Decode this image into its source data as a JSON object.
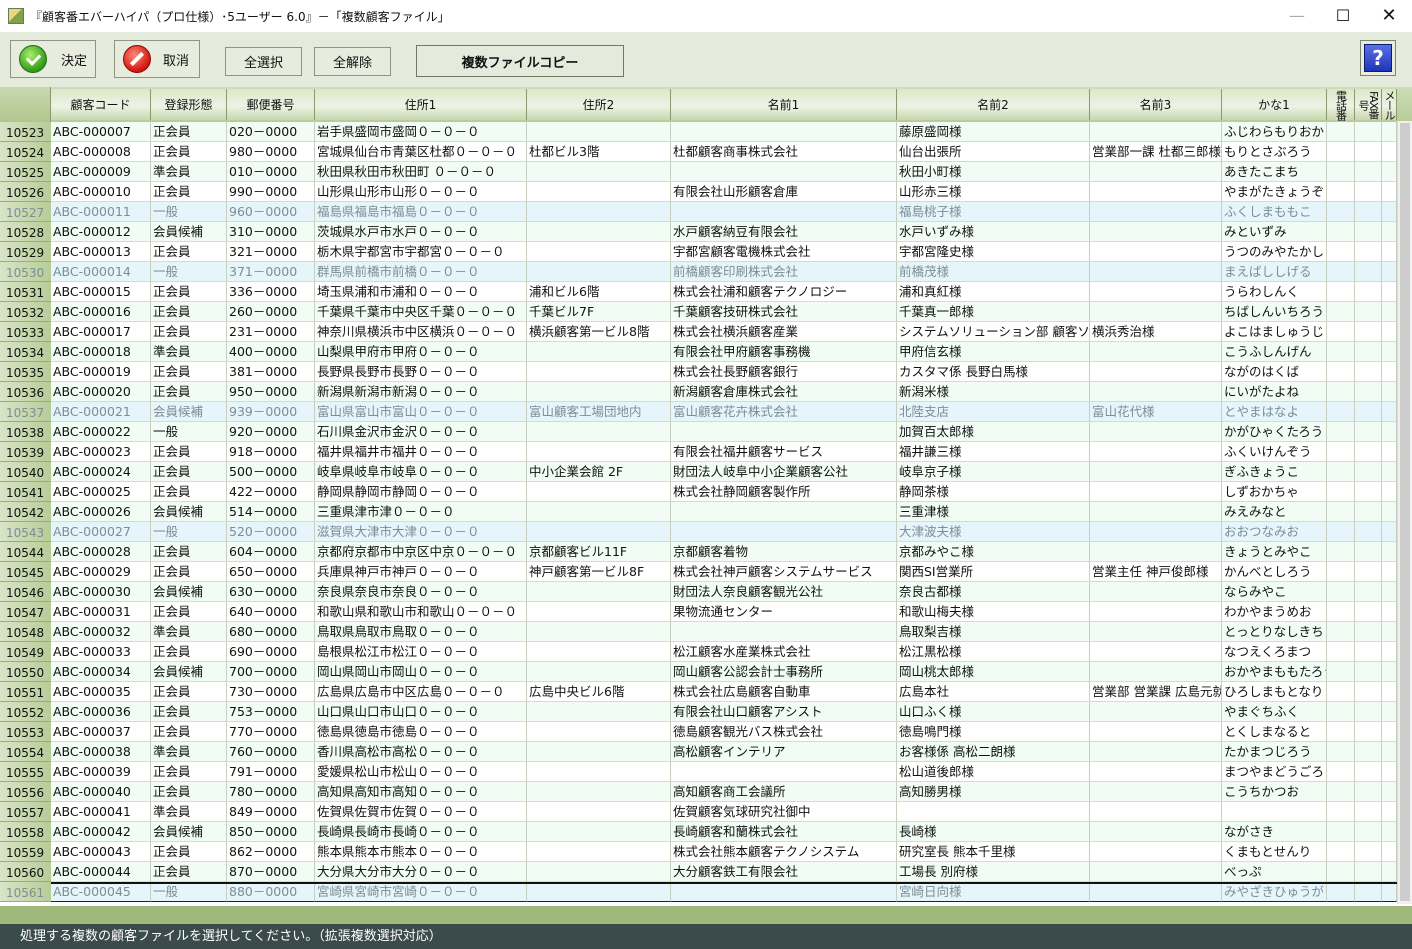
{
  "window": {
    "title": "『顧客番エバーハイパ（プロ仕様）･5ユーザー 6.0』－「複数顧客ファイル」",
    "min_glyph": "—",
    "max_glyph": "☐",
    "close_glyph": "✕"
  },
  "toolbar": {
    "decide_label": "決定",
    "cancel_label": "取消",
    "select_all_label": "全選択",
    "clear_all_label": "全解除",
    "copy_label": "複数ファイルコピー",
    "help_glyph": "?"
  },
  "table": {
    "headers": [
      "顧客コード",
      "登録形態",
      "郵便番号",
      "住所1",
      "住所2",
      "名前1",
      "名前2",
      "名前3",
      "かな1",
      "電話番",
      "FAX番号",
      "メール"
    ],
    "rows": [
      {
        "rownum": "10523",
        "style": "odd",
        "cells": [
          "ABC-000007",
          "正会員",
          "020－0000",
          "岩手県盛岡市盛岡０－０－０",
          "",
          "",
          "藤原盛岡様",
          "",
          "ふじわらもりおか"
        ]
      },
      {
        "rownum": "10524",
        "style": "even",
        "cells": [
          "ABC-000008",
          "正会員",
          "980－0000",
          "宮城県仙台市青葉区杜都０－０－０",
          "杜都ビル3階",
          "杜都顧客商事株式会社",
          "仙台出張所",
          "営業部一課 杜都三郎様",
          "もりとさぶろう"
        ]
      },
      {
        "rownum": "10525",
        "style": "odd",
        "cells": [
          "ABC-000009",
          "準会員",
          "010－0000",
          "秋田県秋田市秋田町 ０－０－０",
          "",
          "",
          "秋田小町様",
          "",
          "あきたこまち"
        ]
      },
      {
        "rownum": "10526",
        "style": "even",
        "cells": [
          "ABC-000010",
          "正会員",
          "990－0000",
          "山形県山形市山形０－０－０",
          "",
          "有限会社山形顧客倉庫",
          "山形赤三様",
          "",
          "やまがたきょうぞう"
        ]
      },
      {
        "rownum": "10527",
        "style": "gray",
        "cells": [
          "ABC-000011",
          "一般",
          "960－0000",
          "福島県福島市福島０－０－０",
          "",
          "",
          "福島桃子様",
          "",
          "ふくしまももこ"
        ]
      },
      {
        "rownum": "10528",
        "style": "odd",
        "cells": [
          "ABC-000012",
          "会員候補",
          "310－0000",
          "茨城県水戸市水戸０－０－０",
          "",
          "水戸顧客納豆有限会社",
          "水戸いずみ様",
          "",
          "みといずみ"
        ]
      },
      {
        "rownum": "10529",
        "style": "even",
        "cells": [
          "ABC-000013",
          "正会員",
          "321－0000",
          "栃木県宇都宮市宇都宮０－０－０",
          "",
          "宇都宮顧客電機株式会社",
          "宇都宮隆史様",
          "",
          "うつのみやたかし"
        ]
      },
      {
        "rownum": "10530",
        "style": "gray",
        "cells": [
          "ABC-000014",
          "一般",
          "371－0000",
          "群馬県前橋市前橋０－０－０",
          "",
          "前橋顧客印刷株式会社",
          "前橋茂様",
          "",
          "まえばししげる"
        ]
      },
      {
        "rownum": "10531",
        "style": "even",
        "cells": [
          "ABC-000015",
          "正会員",
          "336－0000",
          "埼玉県浦和市浦和０－０－０",
          "浦和ビル6階",
          "株式会社浦和顧客テクノロジー",
          "浦和真紅様",
          "",
          "うらわしんく"
        ]
      },
      {
        "rownum": "10532",
        "style": "odd",
        "cells": [
          "ABC-000016",
          "正会員",
          "260－0000",
          "千葉県千葉市中央区千葉０－０－０",
          "千葉ビル7F",
          "千葉顧客技研株式会社",
          "千葉真一郎様",
          "",
          "ちばしんいちろう"
        ]
      },
      {
        "rownum": "10533",
        "style": "even",
        "cells": [
          "ABC-000017",
          "正会員",
          "231－0000",
          "神奈川県横浜市中区横浜０－０－０",
          "横浜顧客第一ビル8階",
          "株式会社横浜顧客産業",
          "システムソリューション部 顧客ソリュー",
          "横浜秀治様",
          "よこはましゅうじ"
        ]
      },
      {
        "rownum": "10534",
        "style": "odd",
        "cells": [
          "ABC-000018",
          "準会員",
          "400－0000",
          "山梨県甲府市甲府０－０－０",
          "",
          "有限会社甲府顧客事務機",
          "甲府信玄様",
          "",
          "こうふしんげん"
        ]
      },
      {
        "rownum": "10535",
        "style": "even",
        "cells": [
          "ABC-000019",
          "正会員",
          "381－0000",
          "長野県長野市長野０－０－０",
          "",
          "株式会社長野顧客銀行",
          "カスタマ係 長野白馬様",
          "",
          "ながのはくば"
        ]
      },
      {
        "rownum": "10536",
        "style": "odd",
        "cells": [
          "ABC-000020",
          "正会員",
          "950－0000",
          "新潟県新潟市新潟０－０－０",
          "",
          "新潟顧客倉庫株式会社",
          "新潟米様",
          "",
          "にいがたよね"
        ]
      },
      {
        "rownum": "10537",
        "style": "gray",
        "cells": [
          "ABC-000021",
          "会員候補",
          "939－0000",
          "富山県富山市富山０－０－０",
          "富山顧客工場団地内",
          "富山顧客花卉株式会社",
          "北陸支店",
          "富山花代様",
          "とやまはなよ"
        ]
      },
      {
        "rownum": "10538",
        "style": "odd",
        "cells": [
          "ABC-000022",
          "一般",
          "920－0000",
          "石川県金沢市金沢０－０－０",
          "",
          "",
          "加賀百太郎様",
          "",
          "かがひゃくたろう"
        ]
      },
      {
        "rownum": "10539",
        "style": "even",
        "cells": [
          "ABC-000023",
          "正会員",
          "918－0000",
          "福井県福井市福井０－０－０",
          "",
          "有限会社福井顧客サービス",
          "福井謙三様",
          "",
          "ふくいけんぞう"
        ]
      },
      {
        "rownum": "10540",
        "style": "odd",
        "cells": [
          "ABC-000024",
          "正会員",
          "500－0000",
          "岐阜県岐阜市岐阜０－０－０",
          "中小企業会館 2F",
          "財団法人岐阜中小企業顧客公社",
          "岐阜京子様",
          "",
          "ぎふきょうこ"
        ]
      },
      {
        "rownum": "10541",
        "style": "even",
        "cells": [
          "ABC-000025",
          "正会員",
          "422－0000",
          "静岡県静岡市静岡０－０－０",
          "",
          "株式会社静岡顧客製作所",
          "静岡茶様",
          "",
          "しずおかちゃ"
        ]
      },
      {
        "rownum": "10542",
        "style": "odd",
        "cells": [
          "ABC-000026",
          "会員候補",
          "514－0000",
          "三重県津市津０－０－０",
          "",
          "",
          "三重津様",
          "",
          "みえみなと"
        ]
      },
      {
        "rownum": "10543",
        "style": "gray",
        "cells": [
          "ABC-000027",
          "一般",
          "520－0000",
          "滋賀県大津市大津０－０－０",
          "",
          "",
          "大津波夫様",
          "",
          "おおつなみお"
        ]
      },
      {
        "rownum": "10544",
        "style": "odd",
        "cells": [
          "ABC-000028",
          "正会員",
          "604－0000",
          "京都府京都市中京区中京０－０－０",
          "京都顧客ビル11F",
          "京都顧客着物",
          "京都みやこ様",
          "",
          "きょうとみやこ"
        ]
      },
      {
        "rownum": "10545",
        "style": "even",
        "cells": [
          "ABC-000029",
          "正会員",
          "650－0000",
          "兵庫県神戸市神戸０－０－０",
          "神戸顧客第一ビル8F",
          "株式会社神戸顧客システムサービス",
          "関西SI営業所",
          "営業主任 神戸俊郎様",
          "かんべとしろう"
        ]
      },
      {
        "rownum": "10546",
        "style": "odd",
        "cells": [
          "ABC-000030",
          "会員候補",
          "630－0000",
          "奈良県奈良市奈良０－０－０",
          "",
          "財団法人奈良顧客観光公社",
          "奈良古都様",
          "",
          "ならみやこ"
        ]
      },
      {
        "rownum": "10547",
        "style": "even",
        "cells": [
          "ABC-000031",
          "正会員",
          "640－0000",
          "和歌山県和歌山市和歌山０－０－０",
          "",
          "果物流通センター",
          "和歌山梅夫様",
          "",
          "わかやまうめお"
        ]
      },
      {
        "rownum": "10548",
        "style": "odd",
        "cells": [
          "ABC-000032",
          "準会員",
          "680－0000",
          "鳥取県鳥取市鳥取０－０－０",
          "",
          "",
          "鳥取梨吉様",
          "",
          "とっとりなしきち"
        ]
      },
      {
        "rownum": "10549",
        "style": "even",
        "cells": [
          "ABC-000033",
          "正会員",
          "690－0000",
          "島根県松江市松江０－０－０",
          "",
          "松江顧客水産業株式会社",
          "松江黒松様",
          "",
          "なつえくろまつ"
        ]
      },
      {
        "rownum": "10550",
        "style": "odd",
        "cells": [
          "ABC-000034",
          "会員候補",
          "700－0000",
          "岡山県岡山市岡山０－０－０",
          "",
          "岡山顧客公認会計士事務所",
          "岡山桃太郎様",
          "",
          "おかやまももたろう"
        ]
      },
      {
        "rownum": "10551",
        "style": "even",
        "cells": [
          "ABC-000035",
          "正会員",
          "730－0000",
          "広島県広島市中区広島０－０－０",
          "広島中央ビル6階",
          "株式会社広島顧客自動車",
          "広島本社",
          "営業部 営業課 広島元就",
          "ひろしまもとなり"
        ]
      },
      {
        "rownum": "10552",
        "style": "odd",
        "cells": [
          "ABC-000036",
          "正会員",
          "753－0000",
          "山口県山口市山口０－０－０",
          "",
          "有限会社山口顧客アシスト",
          "山口ふく様",
          "",
          "やまぐちふく"
        ]
      },
      {
        "rownum": "10553",
        "style": "even",
        "cells": [
          "ABC-000037",
          "正会員",
          "770－0000",
          "徳島県徳島市徳島０－０－０",
          "",
          "徳島顧客観光バス株式会社",
          "徳島鳴門様",
          "",
          "とくしまなると"
        ]
      },
      {
        "rownum": "10554",
        "style": "odd",
        "cells": [
          "ABC-000038",
          "準会員",
          "760－0000",
          "香川県高松市高松０－０－０",
          "",
          "高松顧客インテリア",
          "お客様係 高松二朗様",
          "",
          "たかまつじろう"
        ]
      },
      {
        "rownum": "10555",
        "style": "even",
        "cells": [
          "ABC-000039",
          "正会員",
          "791－0000",
          "愛媛県松山市松山０－０－０",
          "",
          "",
          "松山道後郎様",
          "",
          "まつやまどうごろう"
        ]
      },
      {
        "rownum": "10556",
        "style": "odd",
        "cells": [
          "ABC-000040",
          "正会員",
          "780－0000",
          "高知県高知市高知０－０－０",
          "",
          "高知顧客商工会議所",
          "高知勝男様",
          "",
          "こうちかつお"
        ]
      },
      {
        "rownum": "10557",
        "style": "even",
        "cells": [
          "ABC-000041",
          "準会員",
          "849－0000",
          "佐賀県佐賀市佐賀０－０－０",
          "",
          "佐賀顧客気球研究社御中",
          "",
          "",
          ""
        ]
      },
      {
        "rownum": "10558",
        "style": "odd",
        "cells": [
          "ABC-000042",
          "会員候補",
          "850－0000",
          "長崎県長崎市長崎０－０－０",
          "",
          "長崎顧客和蘭株式会社",
          "長崎様",
          "",
          "ながさき"
        ]
      },
      {
        "rownum": "10559",
        "style": "even",
        "cells": [
          "ABC-000043",
          "正会員",
          "862－0000",
          "熊本県熊本市熊本０－０－０",
          "",
          "株式会社熊本顧客テクノシステム",
          "研究室長 熊本千里様",
          "",
          "くまもとせんり"
        ]
      },
      {
        "rownum": "10560",
        "style": "odd",
        "cells": [
          "ABC-000044",
          "正会員",
          "870－0000",
          "大分県大分市大分０－０－０",
          "",
          "大分顧客鉄工有限会社",
          "工場長 別府様",
          "",
          "べっぷ"
        ]
      },
      {
        "rownum": "10561",
        "style": "gray",
        "cells": [
          "ABC-000045",
          "一般",
          "880－0000",
          "宮崎県宮崎市宮崎０－０－０",
          "",
          "",
          "宮崎日向様",
          "",
          "みやざきひゅうが"
        ]
      }
    ]
  },
  "status": {
    "message": "処理する複数の顧客ファイルを選択してください。（拡張複数選択対応）"
  },
  "colors": {
    "header_green": "#b8cc98",
    "row_odd": "#f0fcf4",
    "row_gray": "#e6f5fa",
    "status_bg": "#3b4a4a"
  }
}
